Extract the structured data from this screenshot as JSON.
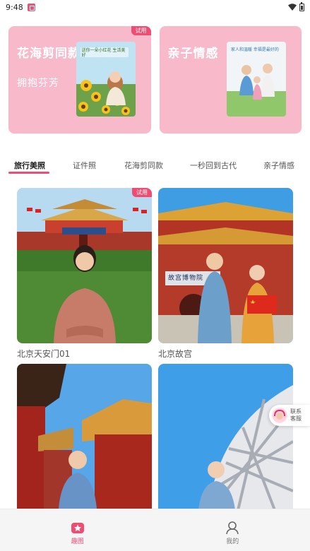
{
  "status_bar": {
    "time": "9:48"
  },
  "promo_cards": [
    {
      "title": "花海剪同款",
      "subtitle": "拥抱芬芳",
      "badge": "试用",
      "thumb_caption": "送你一朵小红花 生活美好"
    },
    {
      "title": "亲子情感",
      "thumb_caption": "家人和温暖 幸福是最好的"
    }
  ],
  "tabs": [
    {
      "label": "旅行美照",
      "active": true
    },
    {
      "label": "证件照",
      "active": false
    },
    {
      "label": "花海剪同款",
      "active": false
    },
    {
      "label": "一秒回到古代",
      "active": false
    },
    {
      "label": "亲子情感",
      "active": false
    }
  ],
  "templates": [
    {
      "label": "北京天安门01",
      "badge": "试用"
    },
    {
      "label": "北京故宫",
      "sign": "故宫博物院"
    },
    {
      "label": ""
    },
    {
      "label": ""
    }
  ],
  "service": {
    "label": "联系客服"
  },
  "bottom_nav": [
    {
      "label": "趣图",
      "icon": "home-star-icon",
      "active": true
    },
    {
      "label": "我的",
      "icon": "profile-icon",
      "active": false
    }
  ],
  "colors": {
    "accent": "#f04c72",
    "card_pink": "#f8bacb"
  }
}
